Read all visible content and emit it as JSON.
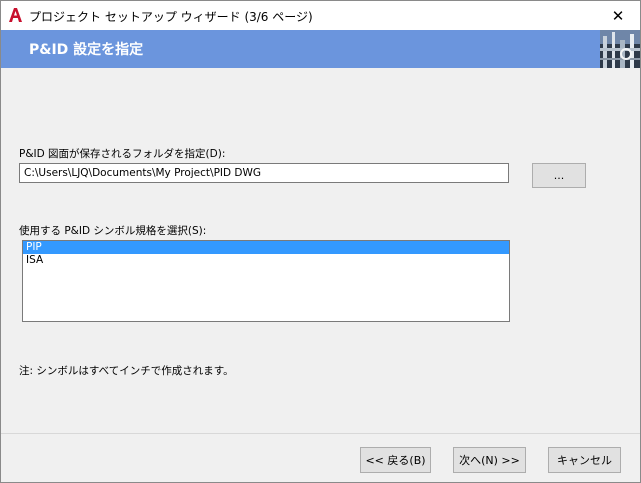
{
  "window": {
    "title": "プロジェクト セットアップ ウィザード (3/6 ページ)",
    "close_glyph": "✕"
  },
  "banner": {
    "title": "P&ID 設定を指定"
  },
  "folder": {
    "label": "P&ID 図面が保存されるフォルダを指定(D):",
    "value": "C:\\Users\\LJQ\\Documents\\My Project\\PID DWG",
    "browse_label": "..."
  },
  "symbols": {
    "label": "使用する P&ID シンボル規格を選択(S):",
    "items": [
      {
        "label": "PIP",
        "selected": true
      },
      {
        "label": "ISA",
        "selected": false
      }
    ]
  },
  "note": "注: シンボルはすべてインチで作成されます。",
  "footer": {
    "back_label": "<< 戻る(B)",
    "next_label": "次へ(N) >>",
    "cancel_label": "キャンセル"
  },
  "colors": {
    "banner": "#6b95dd",
    "selection": "#3399ff",
    "logo_red": "#c8102e"
  },
  "icons": {
    "app": "autocad-logo-icon",
    "close": "close-icon",
    "banner": "plant-pipes-icon"
  }
}
